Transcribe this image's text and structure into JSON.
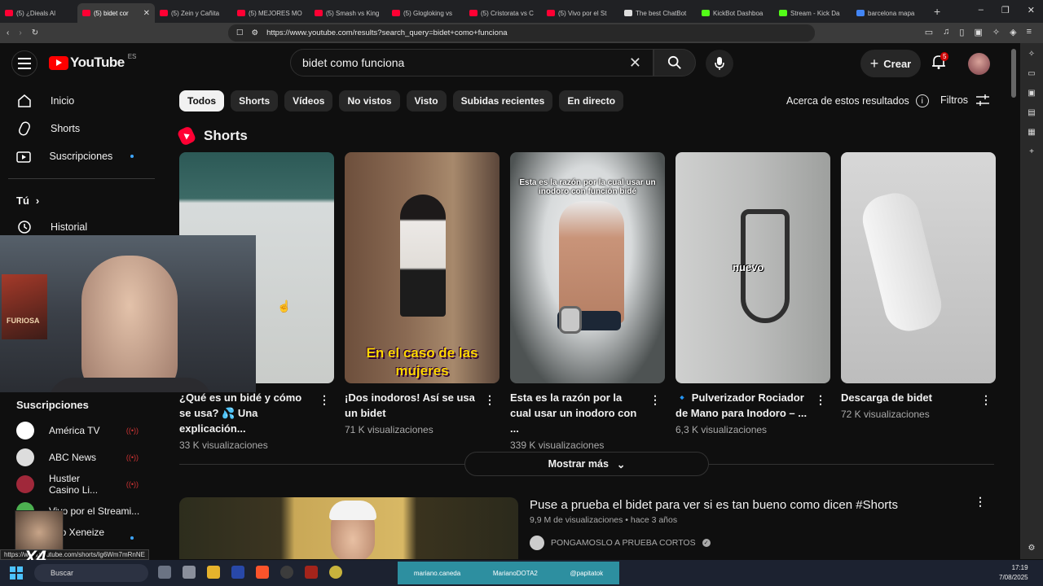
{
  "browser": {
    "tabs": [
      {
        "label": "(5) ¿Dieals Al",
        "color": "#ff0033"
      },
      {
        "label": "(5) bidet cor",
        "color": "#ff0033",
        "active": true
      },
      {
        "label": "(5) Zein y Cañita",
        "color": "#ff0033"
      },
      {
        "label": "(5) MEJORES MO",
        "color": "#ff0033"
      },
      {
        "label": "(5) Smash vs King",
        "color": "#ff0033"
      },
      {
        "label": "(5) Glogloking vs",
        "color": "#ff0033"
      },
      {
        "label": "(5) Cristorata vs C",
        "color": "#ff0033"
      },
      {
        "label": "(5) Vivo por el St",
        "color": "#ff0033"
      },
      {
        "label": "The best ChatBot",
        "color": "#dddddd"
      },
      {
        "label": "KickBot Dashboa",
        "color": "#53fc18"
      },
      {
        "label": "Stream - Kick Da",
        "color": "#53fc18"
      },
      {
        "label": "barcelona mapa",
        "color": "#4285f4"
      }
    ],
    "new_tab": "+",
    "url": "https://www.youtube.com/results?search_query=bidet+como+funciona",
    "status_url": "https://www.youtube.com/shorts/Ig6Wm7mRnNE"
  },
  "header": {
    "logo_text": "YouTube",
    "country": "ES",
    "search_value": "bidet como funciona",
    "create_label": "Crear",
    "notifications": "5"
  },
  "sidebar": {
    "items": [
      {
        "label": "Inicio",
        "icon": "home-icon"
      },
      {
        "label": "Shorts",
        "icon": "shorts-icon"
      },
      {
        "label": "Suscripciones",
        "icon": "subscriptions-icon"
      }
    ],
    "you_label": "Tú",
    "history_label": "Historial",
    "subs_heading": "Suscripciones",
    "subscriptions": [
      {
        "name": "América TV",
        "color": "#ffffff",
        "status": "live"
      },
      {
        "name": "ABC News",
        "color": "#dddddd",
        "status": "live"
      },
      {
        "name": "Hustler Casino Li...",
        "color": "#a0283a",
        "status": "live"
      },
      {
        "name": "Vivo por el Streami...",
        "color": "#4caf50",
        "status": ""
      },
      {
        "name": "Poo Xeneize T...",
        "color": "#1c3e8a",
        "status": "dot"
      }
    ]
  },
  "chips": [
    "Todos",
    "Shorts",
    "Vídeos",
    "No vistos",
    "Visto",
    "Subidas recientes",
    "En directo"
  ],
  "about_label": "Acerca de estos resultados",
  "filters_label": "Filtros",
  "shorts": {
    "heading": "Shorts",
    "items": [
      {
        "title": "¿Qué es un bidé y cómo se usa? 💦 Una explicación...",
        "views": "33 K visualizaciones"
      },
      {
        "title": "¡Dos inodoros! Así se usa un bidet",
        "views": "71 K visualizaciones",
        "overlay": "En el caso de las mujeres"
      },
      {
        "title": "Esta es la razón por la cual usar un inodoro con ...",
        "views": "339 K visualizaciones",
        "overlay": "Esta es la razón por la cual usar un inodoro con función bidé"
      },
      {
        "title": "🔹 Pulverizador Rociador de Mano para Inodoro – ...",
        "views": "6,3 K visualizaciones",
        "overlay": "nuevo"
      },
      {
        "title": "Descarga de bidet",
        "views": "72 K visualizaciones"
      }
    ]
  },
  "show_more": "Mostrar más",
  "result": {
    "title": "Puse a prueba el bidet para ver si es tan bueno como dicen #Shorts",
    "meta": "9,9 M de visualizaciones • hace 3 años",
    "channel": "PONGAMOSLO A PRUEBA CORTOS"
  },
  "overlay_badge": "X4",
  "taskbar": {
    "search": "Buscar",
    "social": [
      "mariano.caneda",
      "MarianoDOTA2",
      "@papitatok"
    ],
    "time": "17:19",
    "date": "7/08/2025"
  }
}
